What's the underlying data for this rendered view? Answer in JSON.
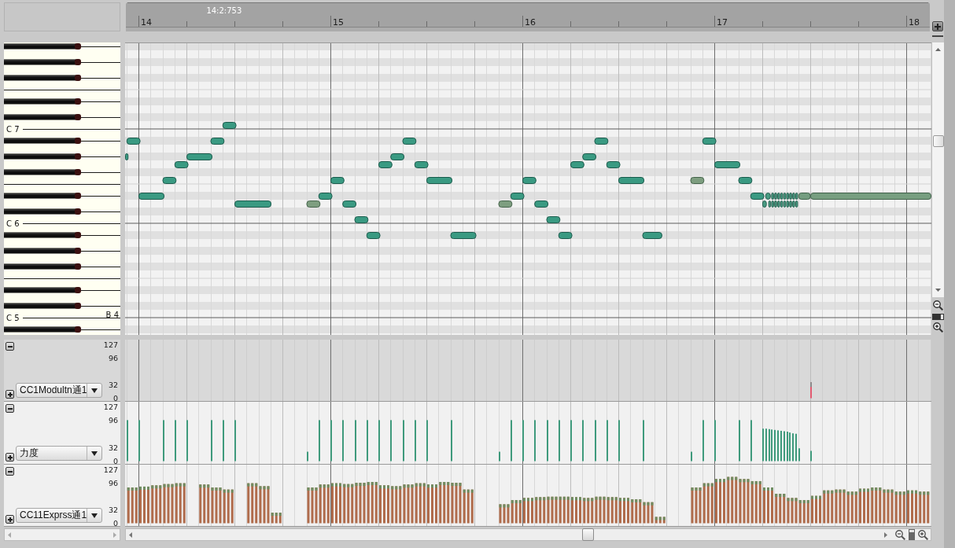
{
  "ruler": {
    "position": "14:2:753",
    "measures": [
      "14",
      "15",
      "16",
      "17",
      "18"
    ]
  },
  "piano_roll": {
    "key_labels": [
      {
        "text": "C 7",
        "kind": "octave"
      },
      {
        "text": "C 6",
        "kind": "octave"
      },
      {
        "text": "C 5",
        "kind": "octave"
      },
      {
        "text": "B 4",
        "kind": "key"
      }
    ]
  },
  "zoom": {
    "vertical": {
      "level": 0.73
    },
    "horizontal": {
      "level": 0.72
    }
  },
  "lanes": [
    {
      "kind": "events",
      "controller": "CC1Modultn通1",
      "selected": true,
      "ticks": [
        "127",
        "96",
        "32",
        "0"
      ]
    },
    {
      "kind": "velocity",
      "controller": "力度",
      "selected": false,
      "ticks": [
        "127",
        "96",
        "32",
        "0"
      ]
    },
    {
      "kind": "bars",
      "controller": "CC11Exprss通1",
      "selected": false,
      "ticks": [
        "127",
        "96",
        "32",
        "0"
      ]
    }
  ]
}
